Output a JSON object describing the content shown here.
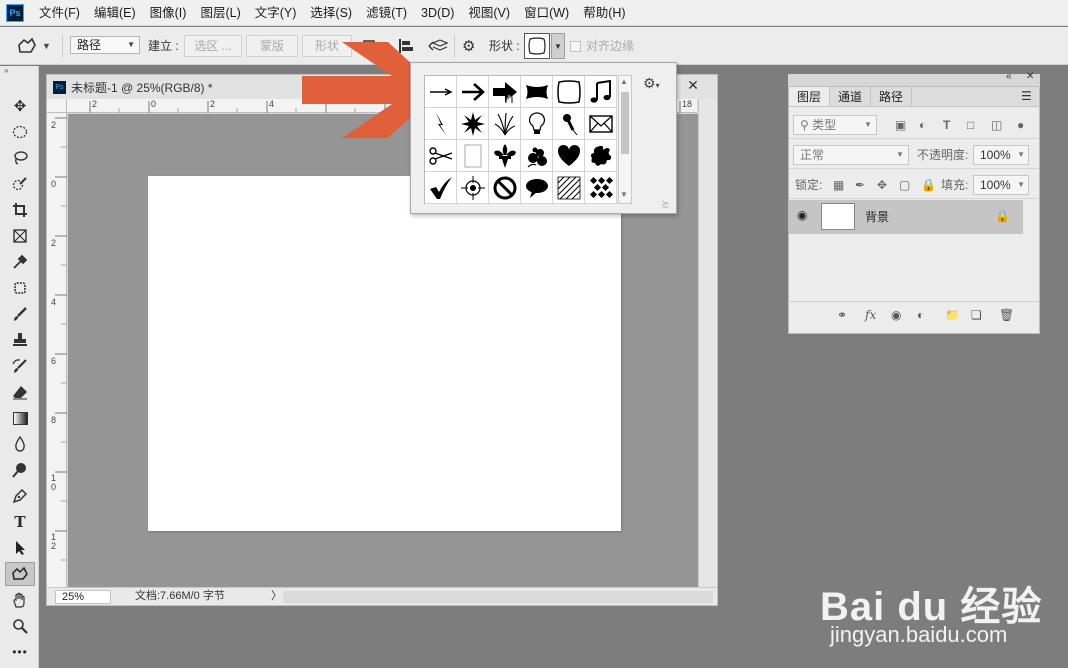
{
  "app": {
    "logo": "Ps"
  },
  "menu": [
    "文件(F)",
    "编辑(E)",
    "图像(I)",
    "图层(L)",
    "文字(Y)",
    "选择(S)",
    "滤镜(T)",
    "3D(D)",
    "视图(V)",
    "窗口(W)",
    "帮助(H)"
  ],
  "options": {
    "mode_value": "路径",
    "make_label": "建立 :",
    "selection_btn": "选区 ...",
    "mask_btn": "蒙版",
    "shape_btn": "形状",
    "shape_label": "形状 :",
    "align_edges_label": "对齐边缘"
  },
  "document": {
    "title": "未标题-1 @ 25%(RGB/8) *",
    "zoom": "25%",
    "info": "文档:7.66M/0 字节",
    "status_arrow": "〉",
    "ruler_top": [
      "2",
      "0",
      "2",
      "4",
      "18"
    ],
    "ruler_left": [
      "2",
      "0",
      "2",
      "4",
      "6",
      "8",
      "1\n0",
      "1\n2"
    ]
  },
  "shape_picker": {
    "shapes": [
      "arrow-thin",
      "arrow-medium",
      "arrow-bold",
      "banner",
      "frame",
      "music-note",
      "lightning",
      "starburst",
      "grass",
      "lightbulb",
      "thumbtack",
      "envelope",
      "scissors",
      "blank-page",
      "fleur-de-lis",
      "flower-cluster",
      "heart",
      "splat",
      "checkmark",
      "target",
      "no-symbol",
      "speech-bubble",
      "hatched-square",
      "checker-diamond"
    ]
  },
  "layers_panel": {
    "tabs": [
      "图层",
      "通道",
      "路径"
    ],
    "filter_label": "类型",
    "blend_mode": "正常",
    "opacity_label": "不透明度:",
    "opacity_value": "100%",
    "lock_label": "锁定:",
    "fill_label": "填充:",
    "fill_value": "100%",
    "layer_name": "背景"
  },
  "watermark": {
    "brand": "Bai du 经验",
    "url": "jingyan.baidu.com"
  },
  "colors": {
    "accent_arrow": "#e0603a",
    "ps_blue": "#31a8ff",
    "ps_dark": "#001e36"
  }
}
